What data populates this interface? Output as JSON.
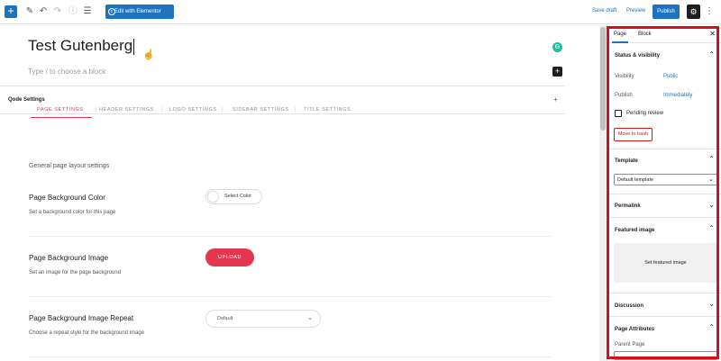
{
  "toolbar": {
    "elementor_label": "Edit with Elementor",
    "save_draft_label": "Save draft",
    "preview_label": "Preview",
    "publish_label": "Publish"
  },
  "editor": {
    "post_title": "Test Gutenberg",
    "block_placeholder": "Type / to choose a block"
  },
  "qode": {
    "title": "Qode Settings",
    "toggle": "+",
    "tabs": [
      "PAGE SETTINGS",
      "HEADER SETTINGS",
      "LOGO SETTINGS",
      "SIDEBAR SETTINGS",
      "TITLE SETTINGS"
    ],
    "intro": "General page layout settings",
    "fields": {
      "bg_color": {
        "title": "Page Background Color",
        "desc": "Set a background color for this page",
        "control": "Select Color"
      },
      "bg_image": {
        "title": "Page Background Image",
        "desc": "Set an image for the page background",
        "control": "UPLOAD"
      },
      "bg_repeat": {
        "title": "Page Background Image Repeat",
        "desc": "Choose a repeat style for the background image",
        "control": "Default"
      }
    }
  },
  "sidebar": {
    "tabs": {
      "page": "Page",
      "block": "Block"
    },
    "status": {
      "title": "Status & visibility",
      "visibility_label": "Visibility",
      "visibility_value": "Public",
      "publish_label": "Publish",
      "publish_value": "Immediately",
      "pending_label": "Pending review",
      "trash_label": "Move to trash"
    },
    "template": {
      "title": "Template",
      "value": "Default template"
    },
    "permalink": {
      "title": "Permalink"
    },
    "featured": {
      "title": "Featured image",
      "button": "Set featured image"
    },
    "discussion": {
      "title": "Discussion"
    },
    "attributes": {
      "title": "Page Attributes",
      "parent_label": "Parent Page"
    }
  },
  "colors": {
    "wp_blue": "#1e73be",
    "qode_accent": "#e5364f",
    "highlight": "#d5101d"
  }
}
